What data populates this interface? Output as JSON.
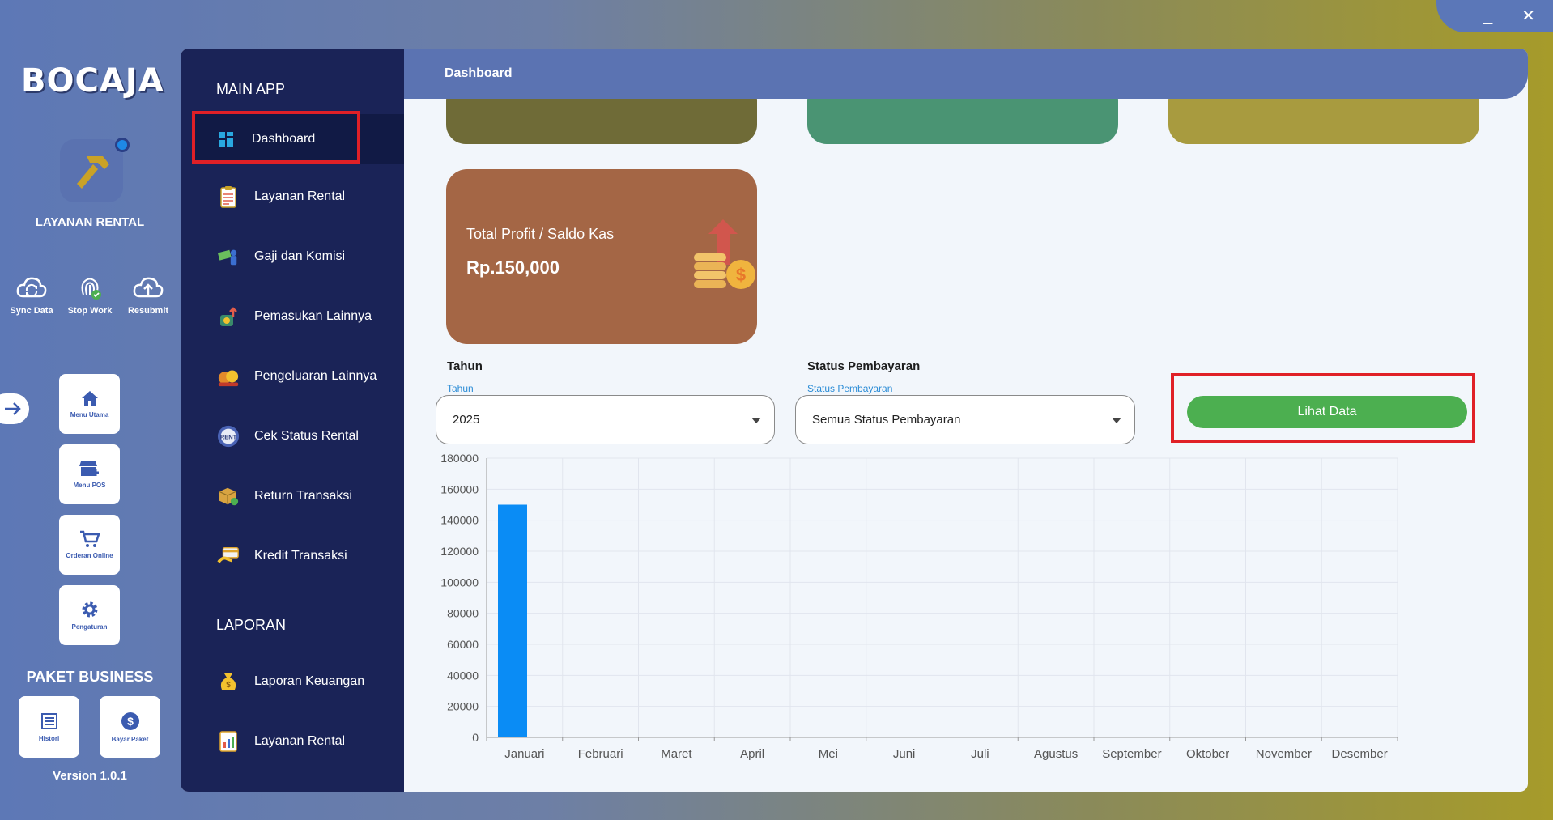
{
  "window": {
    "minimize": "_",
    "close": "✕"
  },
  "rail": {
    "logo": "BOCAJA",
    "app_label": "LAYANAN RENTAL",
    "actions": [
      {
        "label": "Sync Data",
        "icon": "sync-cloud-icon"
      },
      {
        "label": "Stop Work",
        "icon": "fingerprint-icon"
      },
      {
        "label": "Resubmit",
        "icon": "cloud-upload-icon"
      }
    ],
    "tiles": [
      {
        "label": "Menu Utama",
        "icon": "home-icon"
      },
      {
        "label": "Menu POS",
        "icon": "store-icon"
      },
      {
        "label": "Orderan Online",
        "icon": "cart-icon"
      },
      {
        "label": "Pengaturan",
        "icon": "gear-icon"
      }
    ],
    "paket_title": "PAKET BUSINESS",
    "paket_tiles": [
      {
        "label": "Histori",
        "icon": "list-icon"
      },
      {
        "label": "Bayar Paket",
        "icon": "dollar-icon"
      }
    ],
    "version": "Version 1.0.1"
  },
  "sidebar": {
    "main_head": "MAIN APP",
    "main_items": [
      {
        "label": "Dashboard",
        "icon": "dashboard-icon",
        "active": true
      },
      {
        "label": "Layanan Rental",
        "icon": "clipboard-icon"
      },
      {
        "label": "Gaji dan Komisi",
        "icon": "salary-icon"
      },
      {
        "label": "Pemasukan Lainnya",
        "icon": "income-icon"
      },
      {
        "label": "Pengeluaran Lainnya",
        "icon": "expense-icon"
      },
      {
        "label": "Cek Status Rental",
        "icon": "rent-badge-icon"
      },
      {
        "label": "Return Transaksi",
        "icon": "return-box-icon"
      },
      {
        "label": "Kredit Transaksi",
        "icon": "credit-card-icon"
      }
    ],
    "report_head": "LAPORAN",
    "report_items": [
      {
        "label": "Laporan Keuangan",
        "icon": "money-bag-icon"
      },
      {
        "label": "Layanan Rental",
        "icon": "report-icon"
      }
    ]
  },
  "topbar": {
    "title": "Dashboard"
  },
  "stat_cards": {
    "colors": [
      "#6f6b37",
      "#4a9473",
      "#a89b3f"
    ],
    "profit": {
      "label": "Total Profit / Saldo Kas",
      "value": "Rp.150,000",
      "color": "#a46645"
    }
  },
  "filters": {
    "year": {
      "title": "Tahun",
      "hint": "Tahun",
      "value": "2025"
    },
    "status": {
      "title": "Status Pembayaran",
      "hint": "Status Pembayaran",
      "value": "Semua Status Pembayaran"
    },
    "button_label": "Lihat Data"
  },
  "chart_data": {
    "type": "bar",
    "categories": [
      "Januari",
      "Februari",
      "Maret",
      "April",
      "Mei",
      "Juni",
      "Juli",
      "Agustus",
      "September",
      "Oktober",
      "November",
      "Desember"
    ],
    "values": [
      150000,
      0,
      0,
      0,
      0,
      0,
      0,
      0,
      0,
      0,
      0,
      0
    ],
    "y_ticks": [
      0,
      20000,
      40000,
      60000,
      80000,
      100000,
      120000,
      140000,
      160000,
      180000
    ],
    "ylim": [
      0,
      180000
    ],
    "grid": true,
    "bar_color": "#0a8cf5"
  }
}
